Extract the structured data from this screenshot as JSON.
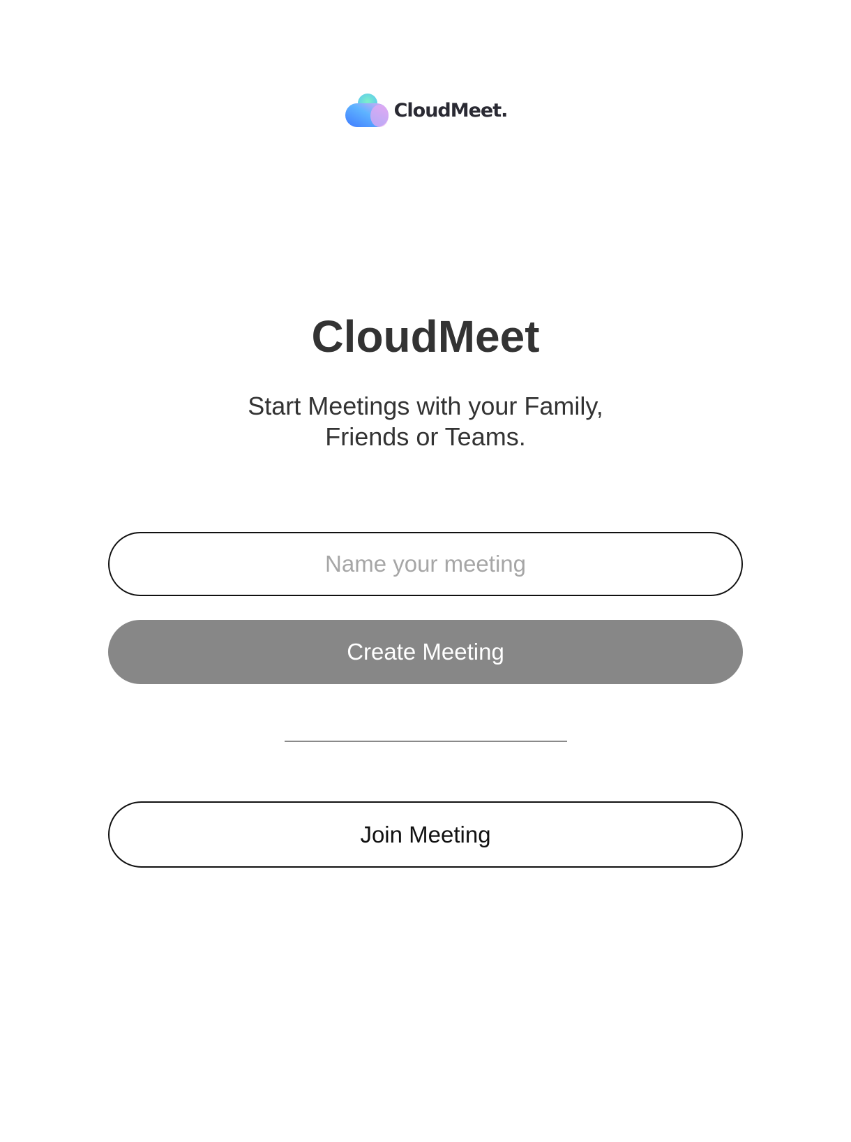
{
  "brand": {
    "logo_icon": "cloud-icon",
    "logo_text": "CloudMeet.",
    "colors": {
      "gradient_blue": "#3f7bff",
      "gradient_teal": "#6ee6d6",
      "gradient_pink": "#e6a8f2",
      "wordmark": "#2a2a33"
    }
  },
  "hero": {
    "title": "CloudMeet",
    "subtitle_line1": "Start Meetings with your Family,",
    "subtitle_line2": "Friends or Teams."
  },
  "create": {
    "input_placeholder": "Name your meeting",
    "input_value": "",
    "button_label": "Create Meeting",
    "button_color": "#878787"
  },
  "join": {
    "button_label": "Join Meeting"
  }
}
